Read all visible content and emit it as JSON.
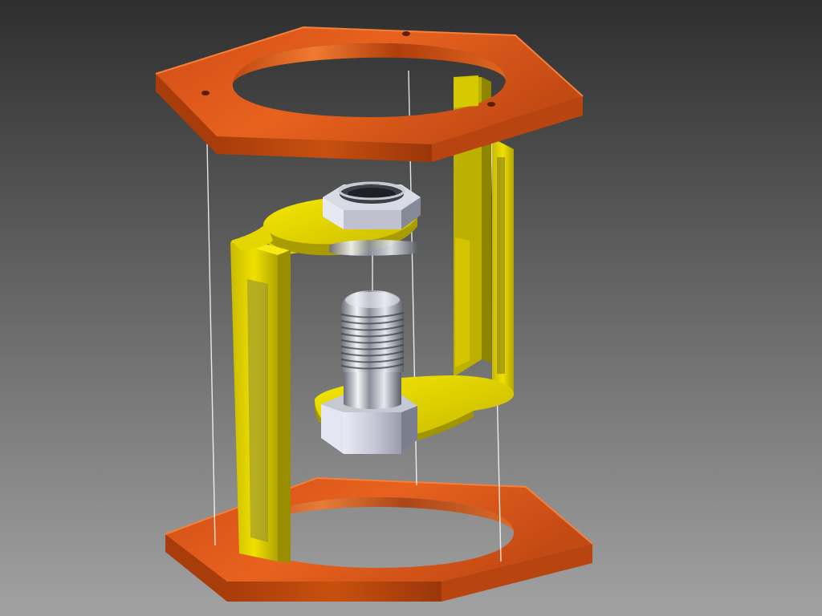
{
  "scene": {
    "kind": "3d-cad-exploded-assembly",
    "colors": {
      "background_top": "#2e2e2e",
      "background_bottom": "#a2a2a2",
      "plate_top_face": "#e0581c",
      "plate_side": "#b8420c",
      "plate_shadow": "#8a2e06",
      "frame_light": "#f4e400",
      "frame_mid": "#d2c400",
      "frame_dark": "#8e8400",
      "steel_light": "#f4f4f8",
      "steel_mid": "#b8bcc8",
      "steel_dark": "#5e626e",
      "assembly_line": "#ffffff"
    },
    "parts": [
      {
        "name": "top-hex-plate",
        "icon": "hexagon-ring"
      },
      {
        "name": "bottom-hex-plate",
        "icon": "hexagon-ring"
      },
      {
        "name": "yellow-c-frame",
        "icon": "frame"
      },
      {
        "name": "threaded-bolt",
        "icon": "bolt"
      },
      {
        "name": "hex-nut",
        "icon": "nut"
      }
    ]
  }
}
